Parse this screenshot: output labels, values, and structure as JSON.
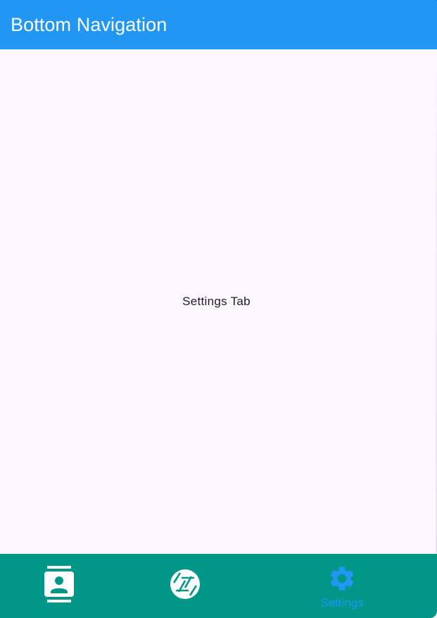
{
  "app_bar": {
    "title": "Bottom Navigation",
    "color": "#2196f3"
  },
  "body": {
    "text": "Settings Tab",
    "background": "#fdf7ff"
  },
  "bottom_nav": {
    "background": "#009688",
    "selected_color": "#2196f3",
    "unselected_color": "#ffffff",
    "items": [
      {
        "icon": "contacts-icon",
        "label": "",
        "selected": false
      },
      {
        "icon": "camera-icon",
        "label": "",
        "selected": false
      },
      {
        "icon": "settings-icon",
        "label": "Settings",
        "selected": true
      }
    ]
  }
}
